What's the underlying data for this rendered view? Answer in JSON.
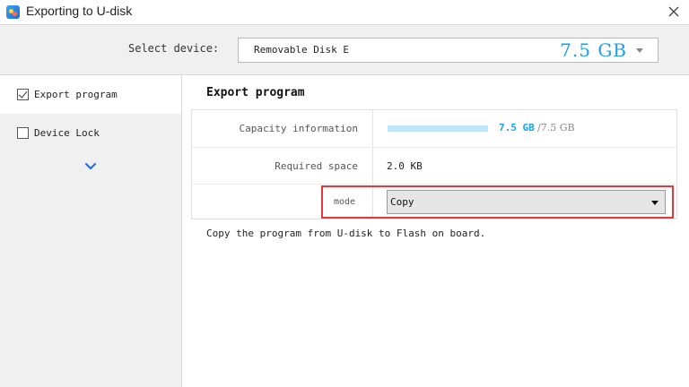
{
  "window": {
    "title": "Exporting to U-disk",
    "icons": {
      "app": "app-icon",
      "close": "close-icon"
    }
  },
  "device": {
    "label": "Select device:",
    "name": "Removable Disk E",
    "size": "7.5 GB",
    "icon": "chevron-down-icon"
  },
  "sidebar": {
    "items": [
      {
        "label": "Export program",
        "checked": true
      },
      {
        "label": "Device Lock",
        "checked": false
      }
    ],
    "expand_icon": "chevron-down-icon"
  },
  "main": {
    "title": "Export program",
    "capacity": {
      "label": "Capacity information",
      "used": "7.5 GB",
      "separator": "/",
      "total": "7.5 GB",
      "fill_fraction": 1.0
    },
    "required": {
      "label": "Required space",
      "value": "2.0 KB"
    },
    "mode": {
      "label": "mode",
      "value": "Copy"
    },
    "description": "Copy the program from U-disk to Flash on board."
  },
  "colors": {
    "accent": "#1aa1e6",
    "highlight": "#e03a3a",
    "capacity_bar": "#bfe6fb"
  }
}
